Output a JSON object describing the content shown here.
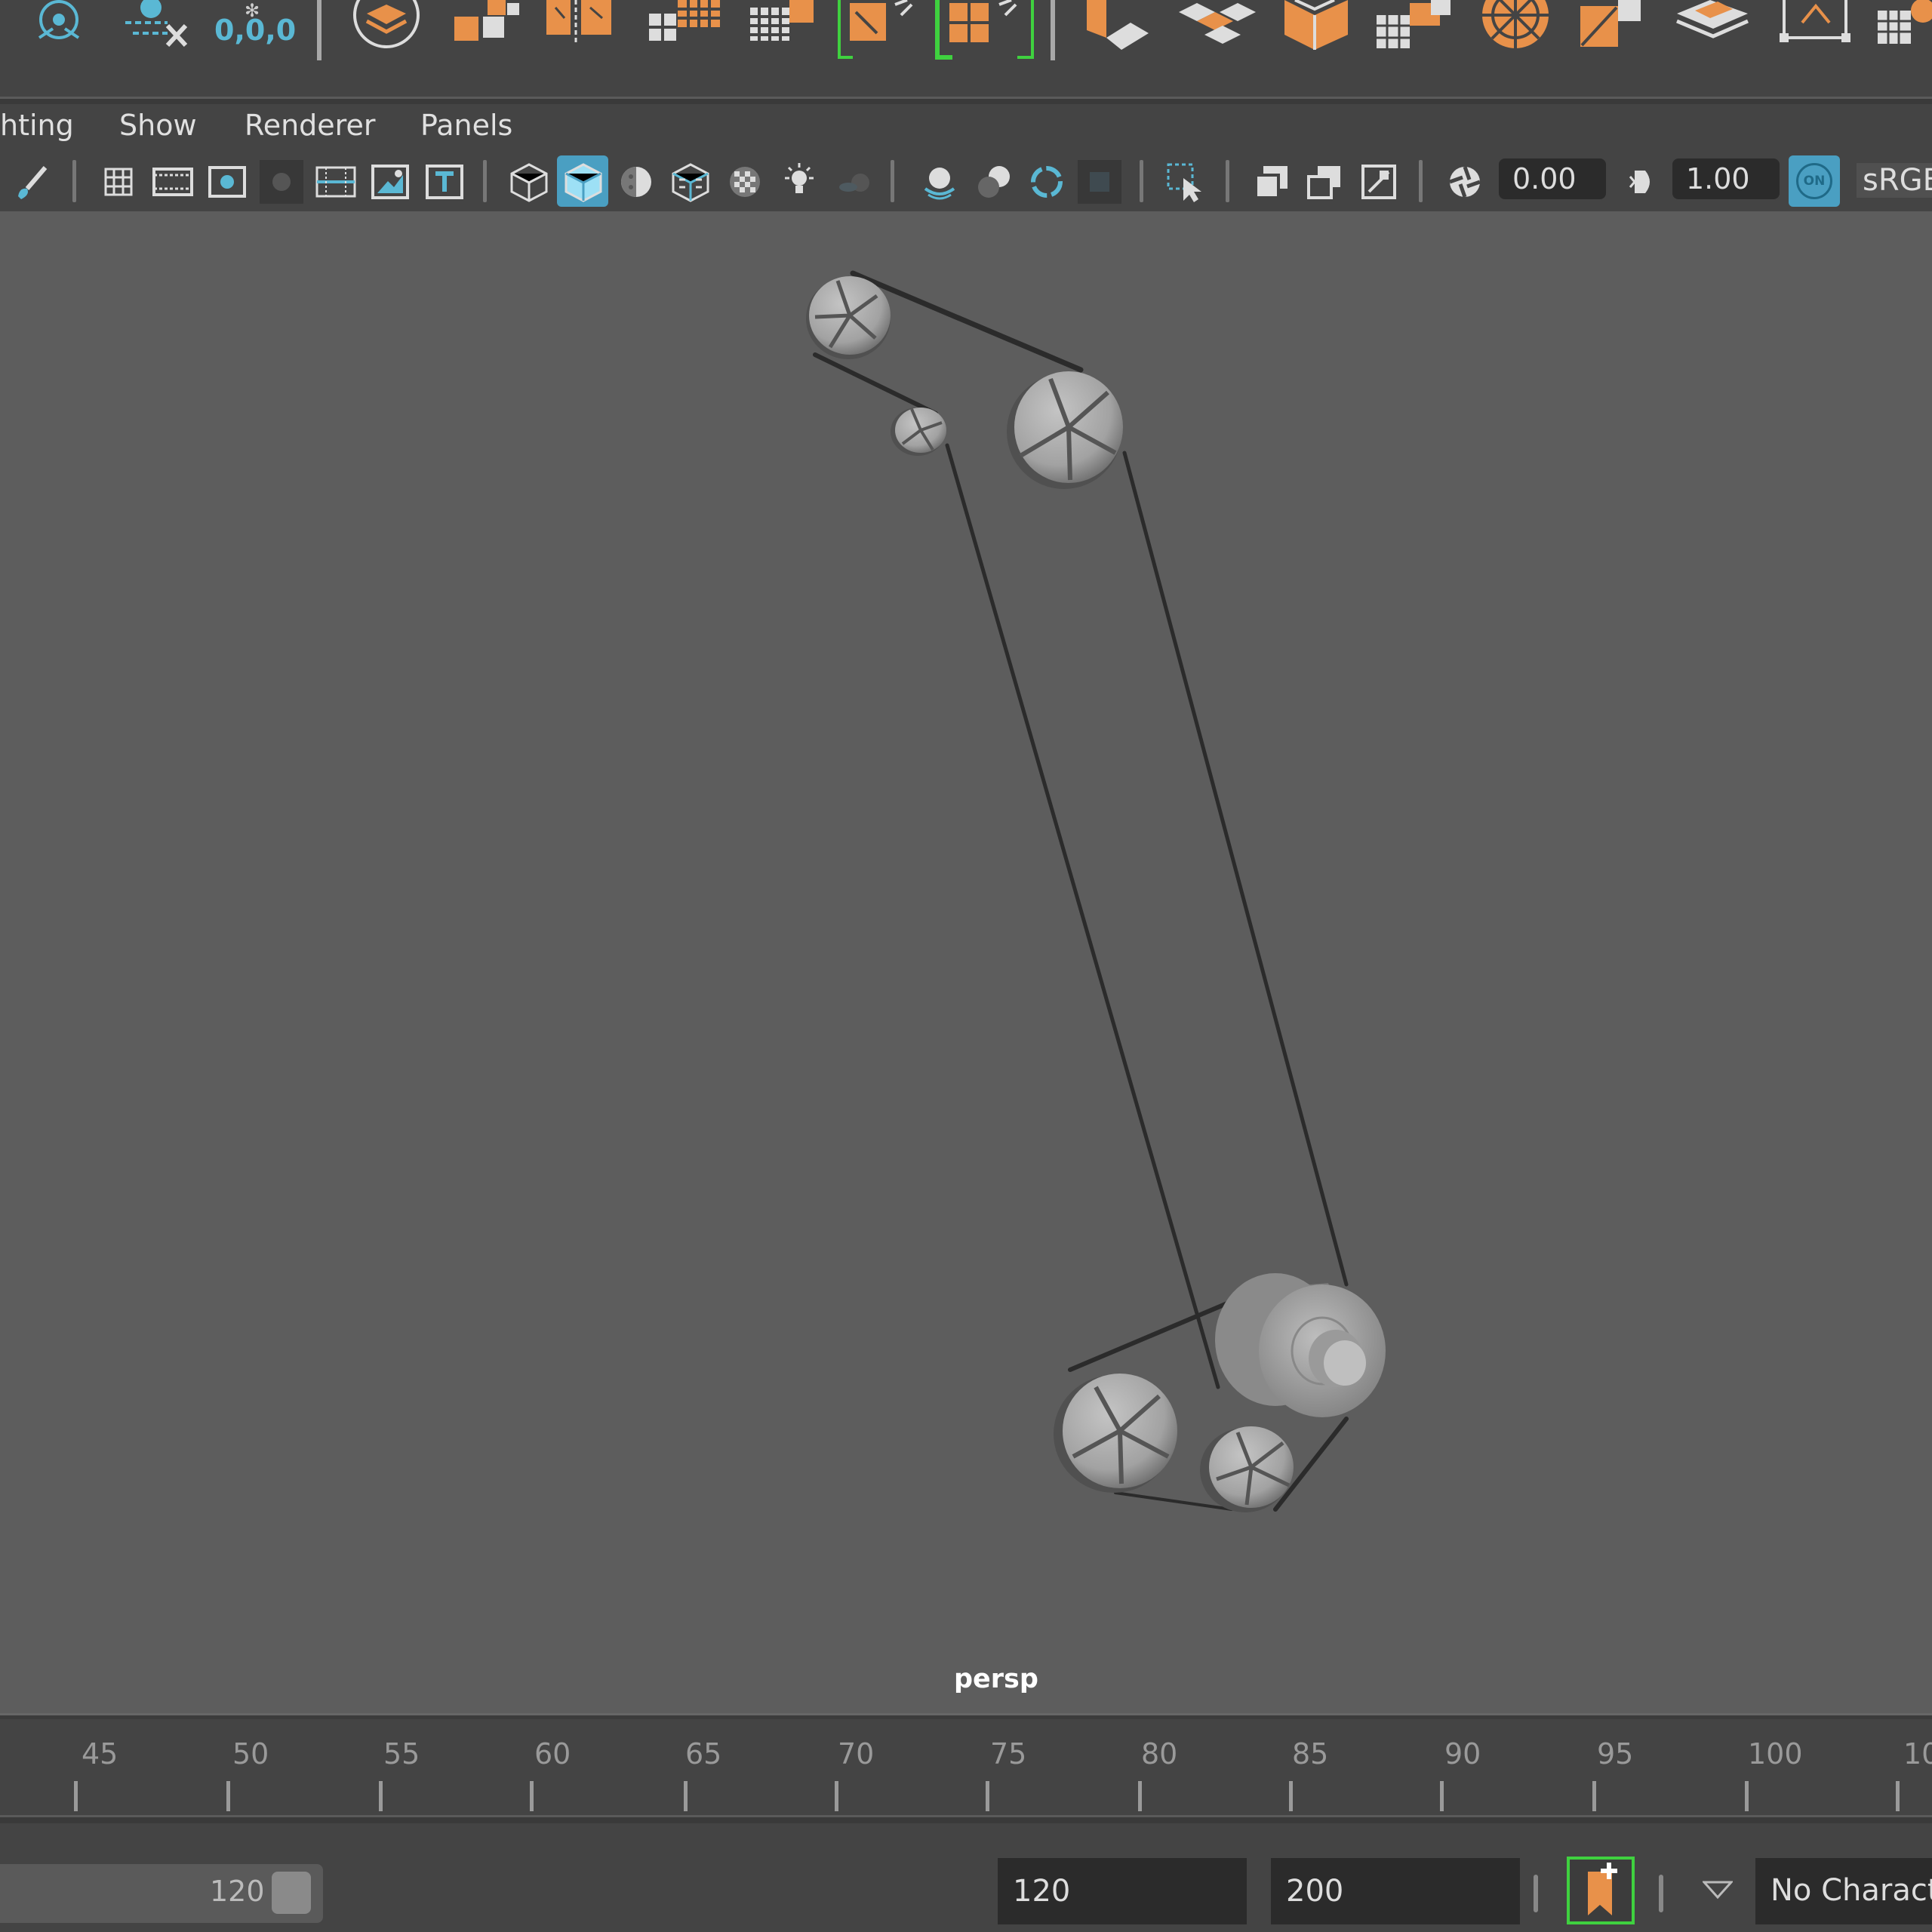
{
  "status_line": {
    "coordinate_readout": "0,0,0"
  },
  "panel_menu": {
    "items": [
      "hting",
      "Show",
      "Renderer",
      "Panels"
    ]
  },
  "panel_toolbar": {
    "exposure_value": "0.00",
    "gamma_value": "1.00",
    "color_space": "sRGB",
    "on_badge": "ON"
  },
  "viewport": {
    "camera_label": "persp"
  },
  "timeline": {
    "ticks": [
      "45",
      "50",
      "55",
      "60",
      "65",
      "70",
      "75",
      "80",
      "85",
      "90",
      "95",
      "100",
      "10"
    ]
  },
  "range": {
    "slider_end_value": "120",
    "playback_end": "120",
    "animation_end": "200",
    "character_set": "No Charact"
  },
  "colors": {
    "accent_orange": "#e8914a",
    "accent_teal": "#5ab8d4",
    "active_blue": "#4a9fc2",
    "selection_green": "#3fd13f"
  }
}
